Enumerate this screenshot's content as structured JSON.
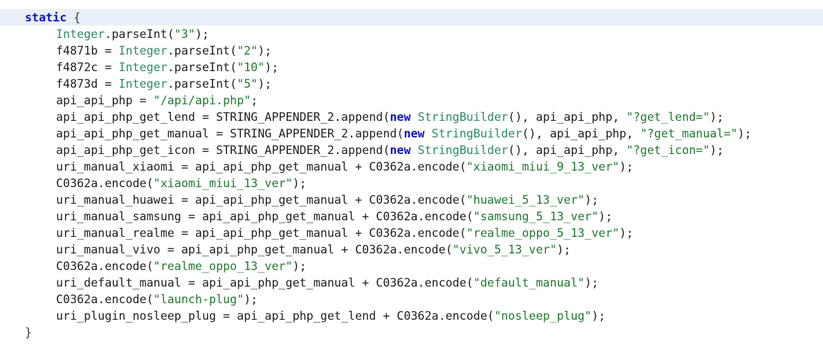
{
  "code": {
    "lines": [
      {
        "indent": 1,
        "tokens": [
          {
            "t": "kw",
            "v": "static"
          },
          {
            "t": "brace",
            "v": " {"
          }
        ]
      },
      {
        "indent": 2,
        "tokens": [
          {
            "t": "type",
            "v": "Integer"
          },
          {
            "t": "plain",
            "v": ".parseInt("
          },
          {
            "t": "str",
            "v": "\"3\""
          },
          {
            "t": "plain",
            "v": ");"
          }
        ]
      },
      {
        "indent": 2,
        "tokens": [
          {
            "t": "plain",
            "v": "f4871b = "
          },
          {
            "t": "type",
            "v": "Integer"
          },
          {
            "t": "plain",
            "v": ".parseInt("
          },
          {
            "t": "str",
            "v": "\"2\""
          },
          {
            "t": "plain",
            "v": ");"
          }
        ]
      },
      {
        "indent": 2,
        "tokens": [
          {
            "t": "plain",
            "v": "f4872c = "
          },
          {
            "t": "type",
            "v": "Integer"
          },
          {
            "t": "plain",
            "v": ".parseInt("
          },
          {
            "t": "str",
            "v": "\"10\""
          },
          {
            "t": "plain",
            "v": ");"
          }
        ]
      },
      {
        "indent": 2,
        "tokens": [
          {
            "t": "plain",
            "v": "f4873d = "
          },
          {
            "t": "type",
            "v": "Integer"
          },
          {
            "t": "plain",
            "v": ".parseInt("
          },
          {
            "t": "str",
            "v": "\"5\""
          },
          {
            "t": "plain",
            "v": ");"
          }
        ]
      },
      {
        "indent": 2,
        "tokens": [
          {
            "t": "plain",
            "v": "api_api_php = "
          },
          {
            "t": "str",
            "v": "\"/api/api.php\""
          },
          {
            "t": "plain",
            "v": ";"
          }
        ]
      },
      {
        "indent": 2,
        "tokens": [
          {
            "t": "plain",
            "v": "api_api_php_get_lend = STRING_APPENDER_2.append("
          },
          {
            "t": "kw",
            "v": "new"
          },
          {
            "t": "plain",
            "v": " "
          },
          {
            "t": "type",
            "v": "StringBuilder"
          },
          {
            "t": "plain",
            "v": "(), api_api_php, "
          },
          {
            "t": "str",
            "v": "\"?get_lend=\""
          },
          {
            "t": "plain",
            "v": ");"
          }
        ]
      },
      {
        "indent": 2,
        "tokens": [
          {
            "t": "plain",
            "v": "api_api_php_get_manual = STRING_APPENDER_2.append("
          },
          {
            "t": "kw",
            "v": "new"
          },
          {
            "t": "plain",
            "v": " "
          },
          {
            "t": "type",
            "v": "StringBuilder"
          },
          {
            "t": "plain",
            "v": "(), api_api_php, "
          },
          {
            "t": "str",
            "v": "\"?get_manual=\""
          },
          {
            "t": "plain",
            "v": ");"
          }
        ]
      },
      {
        "indent": 2,
        "tokens": [
          {
            "t": "plain",
            "v": "api_api_php_get_icon = STRING_APPENDER_2.append("
          },
          {
            "t": "kw",
            "v": "new"
          },
          {
            "t": "plain",
            "v": " "
          },
          {
            "t": "type",
            "v": "StringBuilder"
          },
          {
            "t": "plain",
            "v": "(), api_api_php, "
          },
          {
            "t": "str",
            "v": "\"?get_icon=\""
          },
          {
            "t": "plain",
            "v": ");"
          }
        ]
      },
      {
        "indent": 2,
        "tokens": [
          {
            "t": "plain",
            "v": "uri_manual_xiaomi = api_api_php_get_manual + C0362a.encode("
          },
          {
            "t": "str",
            "v": "\"xiaomi_miui_9_13_ver\""
          },
          {
            "t": "plain",
            "v": ");"
          }
        ]
      },
      {
        "indent": 2,
        "tokens": [
          {
            "t": "plain",
            "v": "C0362a.encode("
          },
          {
            "t": "str",
            "v": "\"xiaomi_miui_13_ver\""
          },
          {
            "t": "plain",
            "v": ");"
          }
        ]
      },
      {
        "indent": 2,
        "tokens": [
          {
            "t": "plain",
            "v": "uri_manual_huawei = api_api_php_get_manual + C0362a.encode("
          },
          {
            "t": "str",
            "v": "\"huawei_5_13_ver\""
          },
          {
            "t": "plain",
            "v": ");"
          }
        ]
      },
      {
        "indent": 2,
        "tokens": [
          {
            "t": "plain",
            "v": "uri_manual_samsung = api_api_php_get_manual + C0362a.encode("
          },
          {
            "t": "str",
            "v": "\"samsung_5_13_ver\""
          },
          {
            "t": "plain",
            "v": ");"
          }
        ]
      },
      {
        "indent": 2,
        "tokens": [
          {
            "t": "plain",
            "v": "uri_manual_realme = api_api_php_get_manual + C0362a.encode("
          },
          {
            "t": "str",
            "v": "\"realme_oppo_5_13_ver\""
          },
          {
            "t": "plain",
            "v": ");"
          }
        ]
      },
      {
        "indent": 2,
        "tokens": [
          {
            "t": "plain",
            "v": "uri_manual_vivo = api_api_php_get_manual + C0362a.encode("
          },
          {
            "t": "str",
            "v": "\"vivo_5_13_ver\""
          },
          {
            "t": "plain",
            "v": ");"
          }
        ]
      },
      {
        "indent": 2,
        "tokens": [
          {
            "t": "plain",
            "v": "C0362a.encode("
          },
          {
            "t": "str",
            "v": "\"realme_oppo_13_ver\""
          },
          {
            "t": "plain",
            "v": ");"
          }
        ]
      },
      {
        "indent": 2,
        "tokens": [
          {
            "t": "plain",
            "v": "uri_default_manual = api_api_php_get_manual + C0362a.encode("
          },
          {
            "t": "str",
            "v": "\"default_manual\""
          },
          {
            "t": "plain",
            "v": ");"
          }
        ]
      },
      {
        "indent": 2,
        "tokens": [
          {
            "t": "plain",
            "v": "C0362a.encode("
          },
          {
            "t": "str",
            "v": "\"launch-plug\""
          },
          {
            "t": "plain",
            "v": ");"
          }
        ]
      },
      {
        "indent": 2,
        "tokens": [
          {
            "t": "plain",
            "v": "uri_plugin_nosleep_plug = api_api_php_get_lend + C0362a.encode("
          },
          {
            "t": "str",
            "v": "\"nosleep_plug\""
          },
          {
            "t": "plain",
            "v": ");"
          }
        ]
      },
      {
        "indent": 1,
        "tokens": [
          {
            "t": "brace",
            "v": "}"
          }
        ]
      }
    ]
  },
  "colors": {
    "keyword": "#0b16c8",
    "type": "#2b8a6a",
    "string": "#1f7a2e",
    "plain": "#1f1f1f",
    "current_line": "#e9eff8"
  }
}
